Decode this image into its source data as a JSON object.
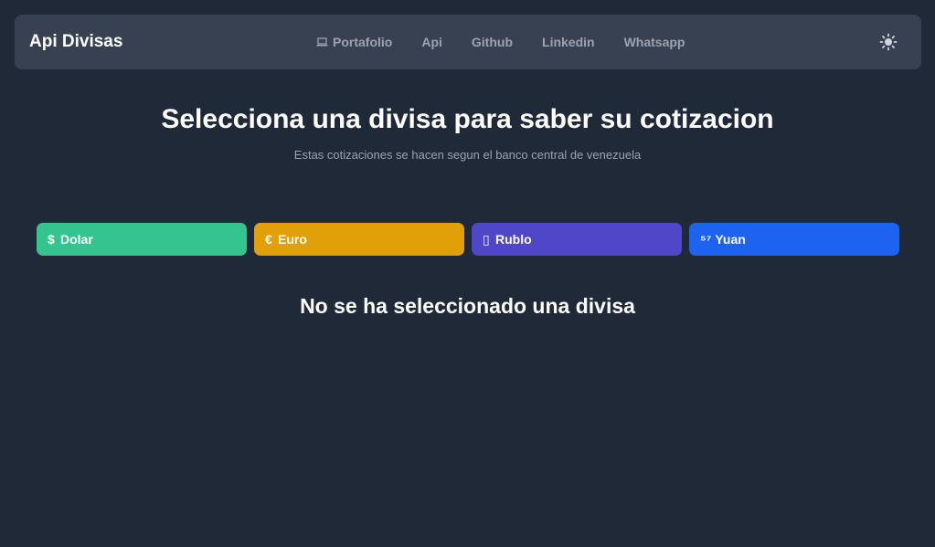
{
  "navbar": {
    "brand": "Api Divisas",
    "links": [
      {
        "label": "Portafolio",
        "icon": "laptop-icon"
      },
      {
        "label": "Api"
      },
      {
        "label": "Github"
      },
      {
        "label": "Linkedin"
      },
      {
        "label": "Whatsapp"
      }
    ],
    "theme_toggle_icon": "sun-icon"
  },
  "hero": {
    "title": "Selecciona una divisa para saber su cotizacion",
    "subtitle": "Estas cotizaciones se hacen segun el banco central de venezuela"
  },
  "currencies": [
    {
      "symbol": "$",
      "label": "Dolar",
      "color": "#34c48e",
      "icon": "dollar-icon"
    },
    {
      "symbol": "€",
      "label": "Euro",
      "color": "#e2a008",
      "icon": "euro-icon"
    },
    {
      "symbol": "▯",
      "label": "Rublo",
      "color": "#5046c8",
      "icon": "ruble-icon"
    },
    {
      "symbol": "⁵⁷",
      "label": "Yuan",
      "color": "#1d63f0",
      "icon": "yuan-icon"
    }
  ],
  "result": {
    "empty_message": "No se ha seleccionado una divisa"
  },
  "colors": {
    "background": "#1f2937",
    "navbar": "#374151",
    "nav_link": "#9ca3af"
  }
}
